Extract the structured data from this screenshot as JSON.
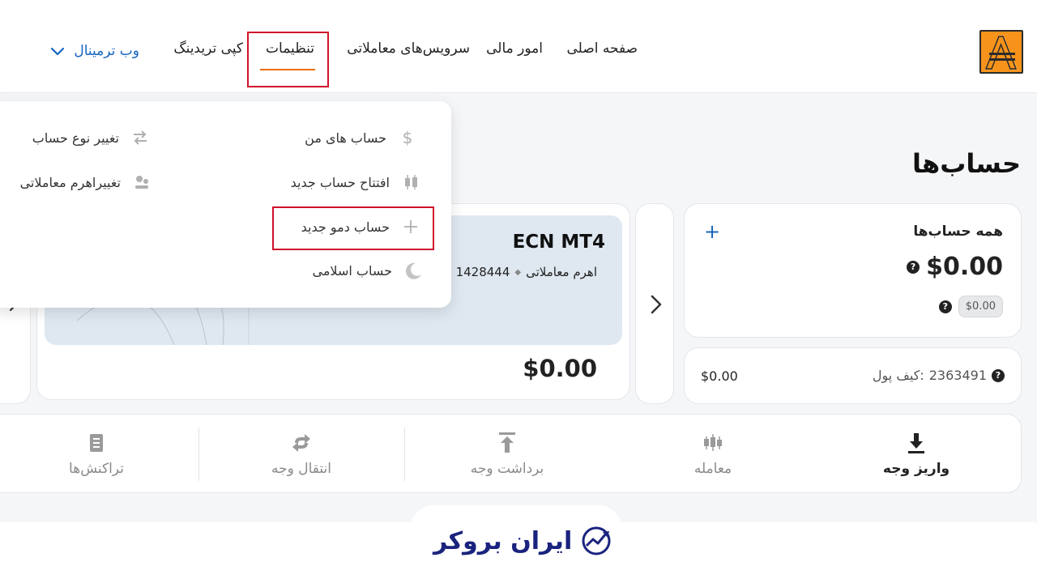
{
  "colors": {
    "accent": "#ef6c00",
    "link": "#1565c0",
    "highlight": "#d0112b",
    "brand": "#1a237e"
  },
  "nav": {
    "home": "صفحه اصلی",
    "finance": "امور مالی",
    "trading_services": "سرویس‌های معاملاتی",
    "settings": "تنظیمات",
    "copy_trading": "کپی تریدینگ",
    "web_terminal": "وب ترمینال"
  },
  "page": {
    "title": "حساب‌ها"
  },
  "all_accounts": {
    "title": "همه حساب‌ها",
    "add_icon": "plus-icon",
    "balance": "$0.00",
    "sub_balance": "$0.00"
  },
  "wallet": {
    "label": "کیف پول:",
    "id": "2363491",
    "balance": "$0.00"
  },
  "ecn": {
    "name": "ECN MT4",
    "account_number": "1428444",
    "separator": "◆",
    "leverage_label": "اهرم معاملاتی",
    "balance": "$0.00"
  },
  "actions": [
    {
      "label": "واریز وجه",
      "icon": "deposit-icon"
    },
    {
      "label": "معامله",
      "icon": "candles-icon"
    },
    {
      "label": "برداشت وجه",
      "icon": "withdraw-icon"
    },
    {
      "label": "انتقال وجه",
      "icon": "transfer-icon"
    },
    {
      "label": "تراکنش‌ها",
      "icon": "transactions-icon"
    }
  ],
  "dropdown": {
    "my_accounts": "حساب های من",
    "open_account": "افتتاح حساب جدید",
    "demo_account": "حساب دمو جدید",
    "islamic_account": "حساب اسلامی",
    "change_type": "تغییر نوع حساب",
    "change_leverage": "تغییراهرم معاملاتی"
  },
  "footer": {
    "brand": "ایران بروکر"
  }
}
